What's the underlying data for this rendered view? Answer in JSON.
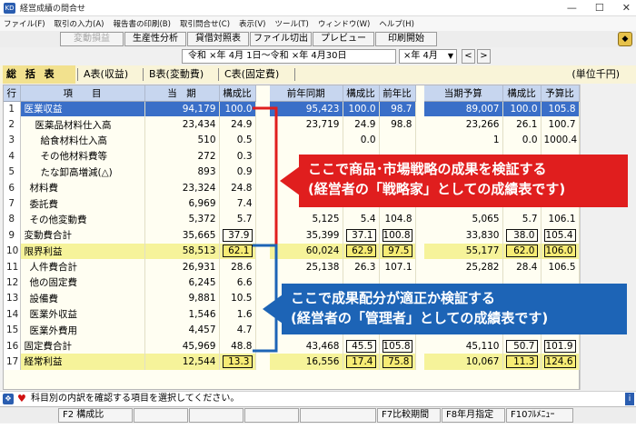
{
  "window": {
    "title": "経営成績の問合せ",
    "controls": [
      "—",
      "☐",
      "✕"
    ]
  },
  "menu": [
    "ファイル(F)",
    "取引の入力(A)",
    "報告書の印刷(B)",
    "取引問合せ(C)",
    "表示(V)",
    "ツール(T)",
    "ウィンドウ(W)",
    "ヘルプ(H)"
  ],
  "toolbar": {
    "buttons": [
      "変動損益",
      "生産性分析",
      "貸借対照表",
      "ファイル切出",
      "プレビュー",
      "印刷開始"
    ],
    "disabled": [
      true,
      false,
      false,
      false,
      false,
      false
    ]
  },
  "period": {
    "range": "令和 ×年 4月 1日〜令和 ×年 4月30日",
    "year_select": "×年 4月",
    "prev_label": "<",
    "next_label": ">"
  },
  "tabs": [
    "総 括 表",
    "A表(収益)",
    "B表(変動費)",
    "C表(固定費)"
  ],
  "unit_label": "(単位千円)",
  "table": {
    "headers": [
      "行",
      "項　　目",
      "当　期",
      "構成比",
      "前年同期",
      "構成比",
      "前年比",
      "当期予算",
      "構成比",
      "予算比"
    ],
    "rows": [
      {
        "n": "1",
        "item": "医業収益",
        "cur": "94,179",
        "cr": "100.0",
        "prev": "95,423",
        "pcr": "100.0",
        "yoy": "98.7",
        "bud": "89,007",
        "bcr": "100.0",
        "br": "105.8"
      },
      {
        "n": "2",
        "item": "医薬品材料仕入高",
        "cur": "23,434",
        "cr": "24.9",
        "prev": "23,719",
        "pcr": "24.9",
        "yoy": "98.8",
        "bud": "23,266",
        "bcr": "26.1",
        "br": "100.7"
      },
      {
        "n": "3",
        "item": "給食材料仕入高",
        "cur": "510",
        "cr": "0.5",
        "prev": "",
        "pcr": "0.0",
        "yoy": "",
        "bud": "1",
        "bcr": "0.0",
        "br": "1000.4"
      },
      {
        "n": "4",
        "item": "その他材料費等",
        "cur": "272",
        "cr": "0.3",
        "prev": "",
        "pcr": "",
        "yoy": "",
        "bud": "",
        "bcr": "",
        "br": ""
      },
      {
        "n": "5",
        "item": "たな卸高増減(△)",
        "cur": "893",
        "cr": "0.9",
        "prev": "",
        "pcr": "",
        "yoy": "",
        "bud": "",
        "bcr": "",
        "br": ""
      },
      {
        "n": "6",
        "item": "材料費",
        "cur": "23,324",
        "cr": "24.8",
        "prev": "",
        "pcr": "",
        "yoy": "",
        "bud": "",
        "bcr": "",
        "br": ""
      },
      {
        "n": "7",
        "item": "委託費",
        "cur": "6,969",
        "cr": "7.4",
        "prev": "",
        "pcr": "",
        "yoy": "",
        "bud": "",
        "bcr": "",
        "br": ""
      },
      {
        "n": "8",
        "item": "その他変動費",
        "cur": "5,372",
        "cr": "5.7",
        "prev": "5,125",
        "pcr": "5.4",
        "yoy": "104.8",
        "bud": "5,065",
        "bcr": "5.7",
        "br": "106.1"
      },
      {
        "n": "9",
        "item": "変動費合計",
        "cur": "35,665",
        "cr": "37.9",
        "prev": "35,399",
        "pcr": "37.1",
        "yoy": "100.8",
        "bud": "33,830",
        "bcr": "38.0",
        "br": "105.4"
      },
      {
        "n": "10",
        "item": "限界利益",
        "cur": "58,513",
        "cr": "62.1",
        "prev": "60,024",
        "pcr": "62.9",
        "yoy": "97.5",
        "bud": "55,177",
        "bcr": "62.0",
        "br": "106.0"
      },
      {
        "n": "11",
        "item": "人件費合計",
        "cur": "26,931",
        "cr": "28.6",
        "prev": "25,138",
        "pcr": "26.3",
        "yoy": "107.1",
        "bud": "25,282",
        "bcr": "28.4",
        "br": "106.5"
      },
      {
        "n": "12",
        "item": "他の固定費",
        "cur": "6,245",
        "cr": "6.6",
        "prev": "",
        "pcr": "",
        "yoy": "",
        "bud": "",
        "bcr": "",
        "br": ""
      },
      {
        "n": "13",
        "item": "設備費",
        "cur": "9,881",
        "cr": "10.5",
        "prev": "",
        "pcr": "",
        "yoy": "",
        "bud": "",
        "bcr": "",
        "br": ""
      },
      {
        "n": "14",
        "item": "医業外収益",
        "cur": "1,546",
        "cr": "1.6",
        "prev": "",
        "pcr": "",
        "yoy": "",
        "bud": "",
        "bcr": "",
        "br": ""
      },
      {
        "n": "15",
        "item": "医業外費用",
        "cur": "4,457",
        "cr": "4.7",
        "prev": "",
        "pcr": "",
        "yoy": "",
        "bud": "",
        "bcr": "",
        "br": ""
      },
      {
        "n": "16",
        "item": "固定費合計",
        "cur": "45,969",
        "cr": "48.8",
        "prev": "43,468",
        "pcr": "45.5",
        "yoy": "105.8",
        "bud": "45,110",
        "bcr": "50.7",
        "br": "101.9"
      },
      {
        "n": "17",
        "item": "経常利益",
        "cur": "12,544",
        "cr": "13.3",
        "prev": "16,556",
        "pcr": "17.4",
        "yoy": "75.8",
        "bud": "10,067",
        "bcr": "11.3",
        "br": "124.6"
      }
    ]
  },
  "callouts": {
    "red_line1": "ここで商品･市場戦略の成果を検証する",
    "red_line2": "(経営者の「戦略家」としての成績表です)",
    "blue_line1": "ここで成果配分が適正か検証する",
    "blue_line2": "(経営者の「管理者」としての成績表です)"
  },
  "status": {
    "message": "科目別の内訳を確認する項目を選択してください。"
  },
  "fkeys": [
    "F2 構成比",
    "F7比較期間",
    "F8年月指定",
    "F10ﾌﾙﾒﾆｭｰ"
  ],
  "colors": {
    "accent_blue": "#3a6fc8",
    "highlight_yellow": "#f6f39a",
    "callout_red": "#e01e1e",
    "callout_blue": "#1d64b6"
  }
}
